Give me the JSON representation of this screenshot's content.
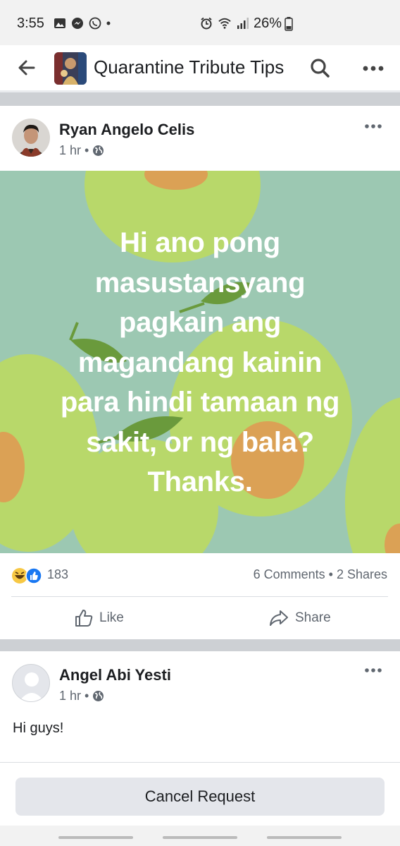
{
  "status_bar": {
    "time": "3:55",
    "battery": "26%"
  },
  "header": {
    "group_title": "Quarantine Tribute Tips"
  },
  "post": {
    "author": "Ryan Angelo Celis",
    "time": "1 hr",
    "privacy_icon": "globe-icon",
    "text": "Hi ano pong\nmasustansyang\npagkain ang\nmagandang kainin\npara hindi tamaan ng\nsakit, or ng bala?\nThanks.",
    "background_color": "#9cc8b2",
    "reaction_count": "183",
    "comments_shares": "6 Comments • 2 Shares",
    "like_label": "Like",
    "share_label": "Share"
  },
  "comment_post": {
    "author": "Angel Abi Yesti",
    "time": "1 hr",
    "text": "Hi guys!"
  },
  "footer": {
    "cancel_label": "Cancel Request"
  },
  "colors": {
    "text": "#1c1e21",
    "secondary": "#606770",
    "divider": "#cdd0d4",
    "like_blue": "#1877f2"
  }
}
